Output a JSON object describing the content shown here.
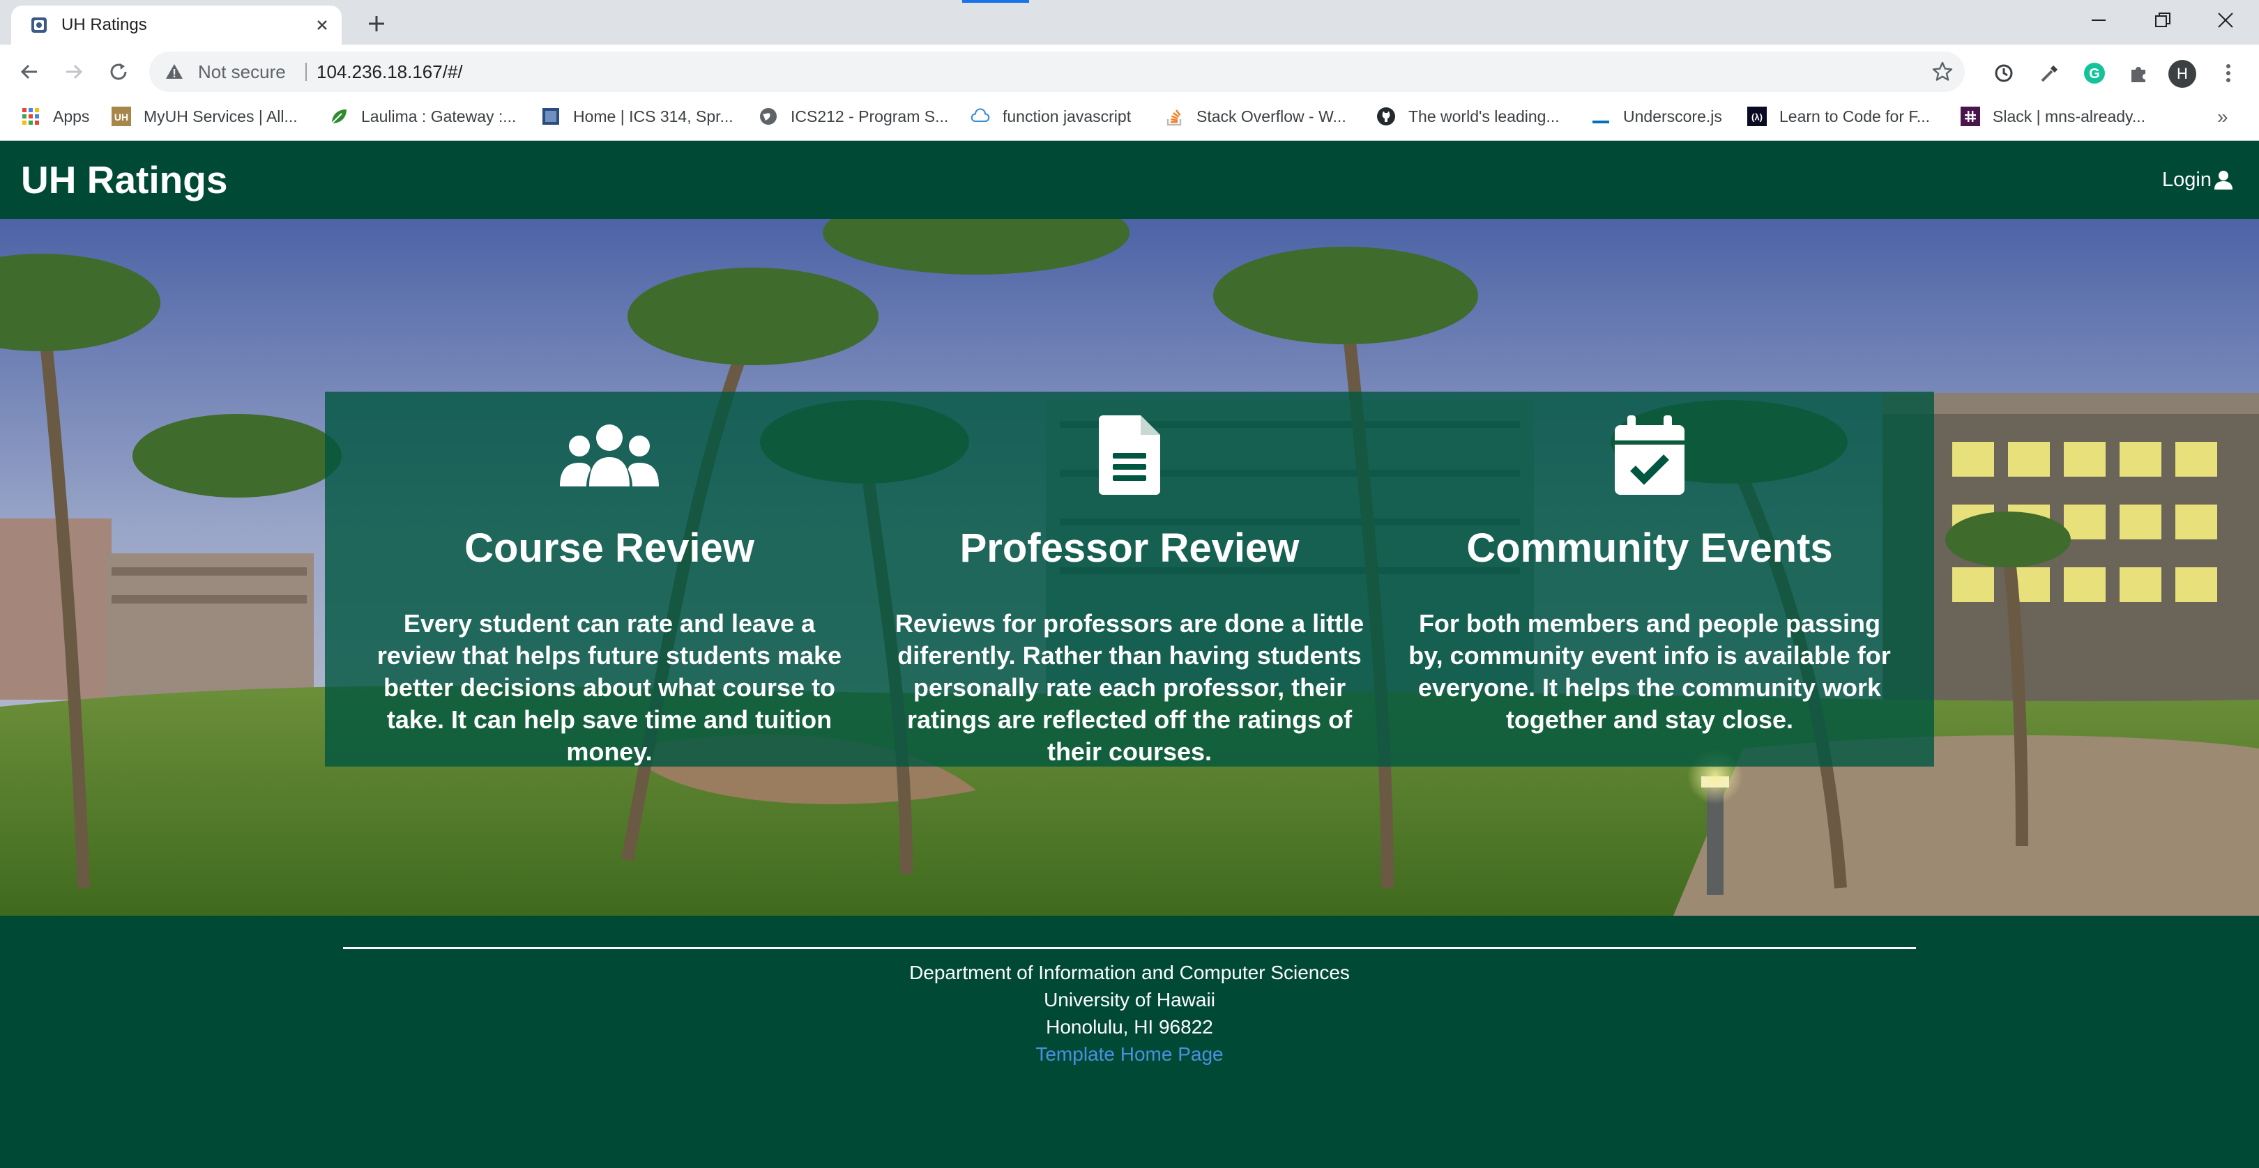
{
  "browser": {
    "tab": {
      "title": "UH Ratings",
      "favicon": "site-favicon"
    },
    "address": {
      "security_label": "Not secure",
      "url": "104.236.18.167/#/"
    },
    "profile_initial": "H",
    "bookmarks": [
      {
        "label": "Apps",
        "icon": "apps-grid-icon"
      },
      {
        "label": "MyUH Services | All...",
        "icon": "uh-logo-icon"
      },
      {
        "label": "Laulima : Gateway :...",
        "icon": "leaf-icon"
      },
      {
        "label": "Home | ICS 314, Spr...",
        "icon": "page-icon"
      },
      {
        "label": "ICS212 - Program S...",
        "icon": "globe-icon"
      },
      {
        "label": "function javascript",
        "icon": "cloud-icon"
      },
      {
        "label": "Stack Overflow - W...",
        "icon": "stackoverflow-icon"
      },
      {
        "label": "The world's leading...",
        "icon": "github-icon"
      },
      {
        "label": "Underscore.js",
        "icon": "underscore-icon"
      },
      {
        "label": "Learn to Code for F...",
        "icon": "freecodecamp-icon"
      },
      {
        "label": "Slack | mns-already...",
        "icon": "slack-icon"
      }
    ],
    "more_bookmarks": "»"
  },
  "site": {
    "brand": "UH Ratings",
    "login_label": "Login",
    "features": [
      {
        "icon": "users-icon",
        "title": "Course Review",
        "text": "Every student can rate and leave a review that helps future students make better decisions about what course to take. It can help save time and tuition money."
      },
      {
        "icon": "document-icon",
        "title": "Professor Review",
        "text": "Reviews for professors are done a little diferently. Rather than having students personally rate each professor, their ratings are reflected off the ratings of their courses."
      },
      {
        "icon": "calendar-check-icon",
        "title": "Community Events",
        "text": "For both members and people passing by, community event info is available for everyone. It helps the community work together and stay close."
      }
    ],
    "footer": {
      "line1": "Department of Information and Computer Sciences",
      "line2": "University of Hawaii",
      "line3": "Honolulu, HI 96822",
      "link": "Template Home Page"
    }
  },
  "colors": {
    "brand_green": "#004a35",
    "panel_green": "#005640",
    "link_blue": "#4a90e2"
  }
}
